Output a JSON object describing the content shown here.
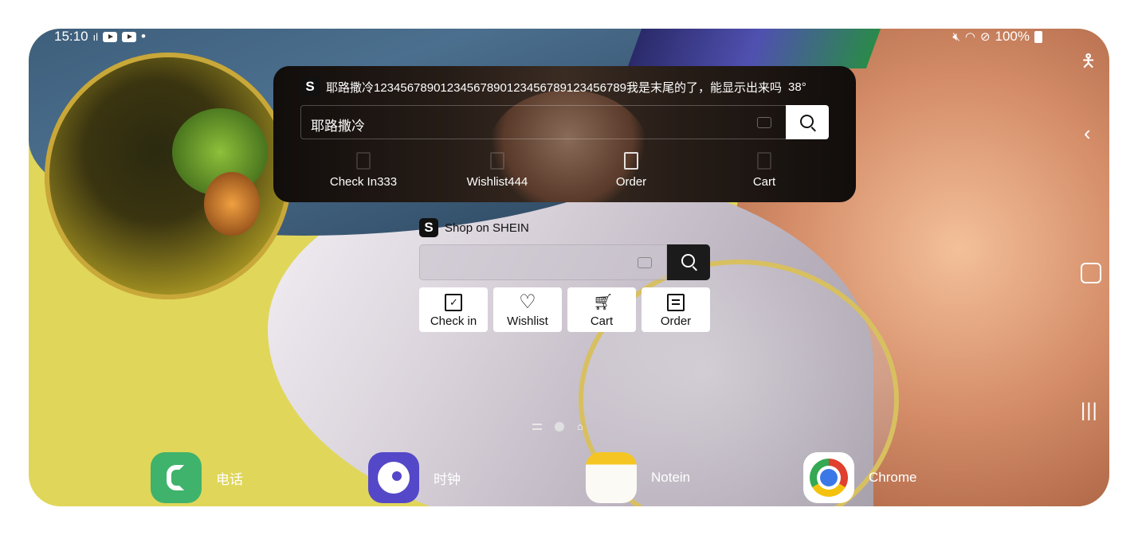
{
  "status_bar": {
    "time": "15:10",
    "battery": "100%"
  },
  "widget_dark": {
    "title": "耶路撒冷12345678901234567890123456789123456789我是末尾的了，能显示出来吗",
    "temperature": "38°",
    "search_value": "耶路撒冷",
    "nav": [
      {
        "label": "Check In333"
      },
      {
        "label": "Wishlist444"
      },
      {
        "label": "Order"
      },
      {
        "label": "Cart"
      }
    ]
  },
  "widget_light": {
    "title": "Shop on SHEIN",
    "search_value": "",
    "tiles": [
      {
        "label": "Check in",
        "icon": "calendar-check-icon"
      },
      {
        "label": "Wishlist",
        "icon": "heart-icon"
      },
      {
        "label": "Cart",
        "icon": "cart-icon"
      },
      {
        "label": "Order",
        "icon": "order-icon"
      }
    ]
  },
  "dock": {
    "apps": [
      {
        "name": "电话",
        "icon": "phone-icon",
        "color": "#3fb36b"
      },
      {
        "name": "时钟",
        "icon": "clock-icon",
        "color": "#5448c8"
      },
      {
        "name": "Notein",
        "icon": "notes-icon",
        "color": "#f5c623"
      },
      {
        "name": "Chrome",
        "icon": "chrome-icon",
        "color": "#ffffff"
      }
    ]
  },
  "logo_letter": "S"
}
